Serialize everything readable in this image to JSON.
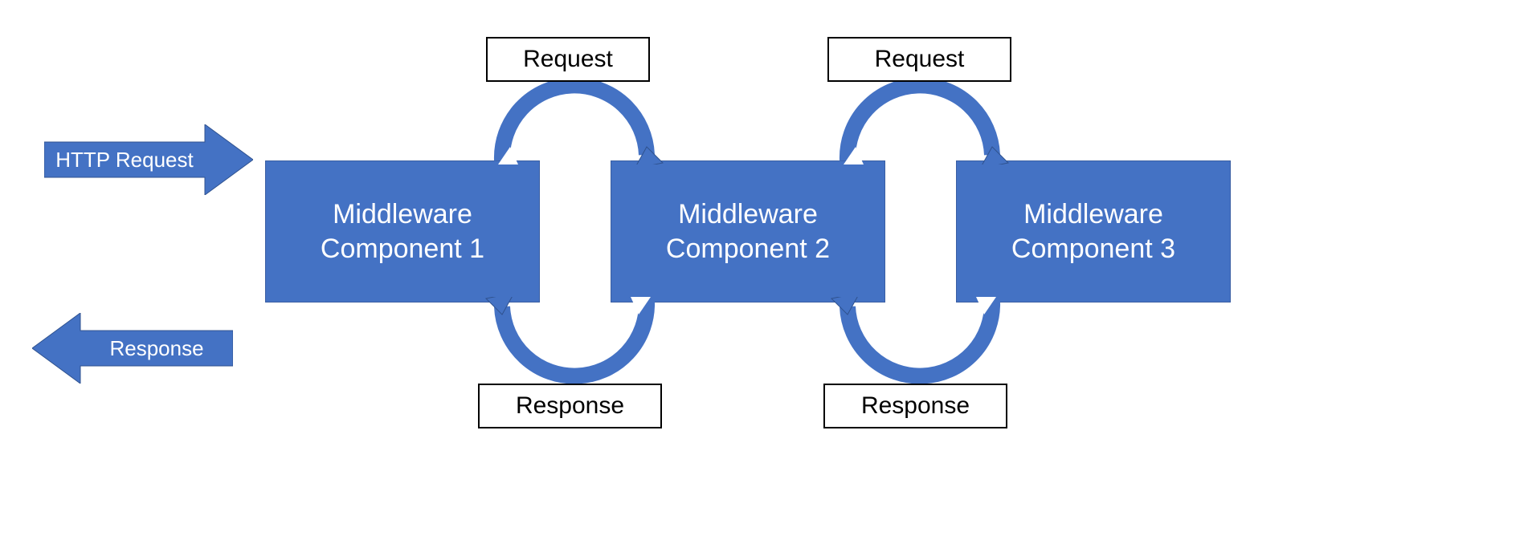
{
  "colors": {
    "primary": "#4472C4",
    "primaryStroke": "#2f528f",
    "black": "#000000",
    "white": "#ffffff"
  },
  "arrows": {
    "http_request_label": "HTTP Request",
    "http_response_label": "Response"
  },
  "middleware": {
    "box1": "Middleware\nComponent 1",
    "box2": "Middleware\nComponent 2",
    "box3": "Middleware\nComponent 3"
  },
  "labels": {
    "request": "Request",
    "response": "Response"
  },
  "flow": {
    "description": "HTTP request enters Middleware Component 1, passes as Request to Component 2, then to Component 3; Response returns back through Component 2 then Component 1 then out."
  }
}
